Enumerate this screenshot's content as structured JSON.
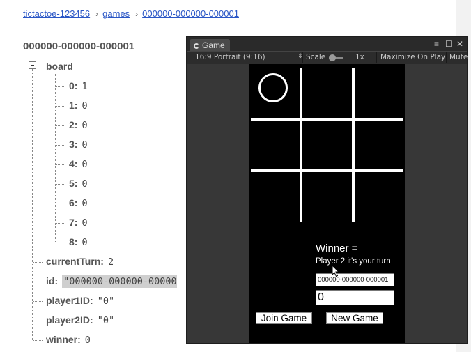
{
  "breadcrumb": {
    "items": [
      "tictactoe-123456",
      "games",
      "000000-000000-000001"
    ],
    "separator": "›"
  },
  "tree": {
    "root_key": "000000-000000-000001",
    "board": {
      "key": "board",
      "items": [
        {
          "key": "0:",
          "value": "1"
        },
        {
          "key": "1:",
          "value": "0"
        },
        {
          "key": "2:",
          "value": "0"
        },
        {
          "key": "3:",
          "value": "0"
        },
        {
          "key": "4:",
          "value": "0"
        },
        {
          "key": "5:",
          "value": "0"
        },
        {
          "key": "6:",
          "value": "0"
        },
        {
          "key": "7:",
          "value": "0"
        },
        {
          "key": "8:",
          "value": "0"
        }
      ]
    },
    "fields": [
      {
        "key": "currentTurn:",
        "value": "2"
      },
      {
        "key": "id:",
        "value": "\"000000-000000-00000"
      },
      {
        "key": "player1ID:",
        "value": "\"0\""
      },
      {
        "key": "player2ID:",
        "value": "\"0\""
      },
      {
        "key": "winner:",
        "value": "0"
      }
    ]
  },
  "game_window": {
    "tab_label": "Game",
    "controls": {
      "menu": "≡",
      "maximize": "☐",
      "close": "✕"
    },
    "toolbar": {
      "aspect": "16:9 Portrait (9:16)",
      "scale_label": "Scale",
      "scale_value": "1x",
      "maximize_on_play": "Maximize On Play",
      "mute": "Mute"
    },
    "game": {
      "board_cells": [
        "O",
        "",
        "",
        "",
        "",
        "",
        "",
        "",
        ""
      ],
      "winner_text": "Winner =",
      "status_text": "Player 2 it's your turn",
      "game_id_value": "000000-000000-000001",
      "turn_value": "0",
      "join_button": "Join Game",
      "new_button": "New Game"
    }
  },
  "colors": {
    "link": "#2a56c6",
    "editor_bg": "#3a3a3a",
    "game_bg": "#000000",
    "selection": "#cfcfcf"
  }
}
